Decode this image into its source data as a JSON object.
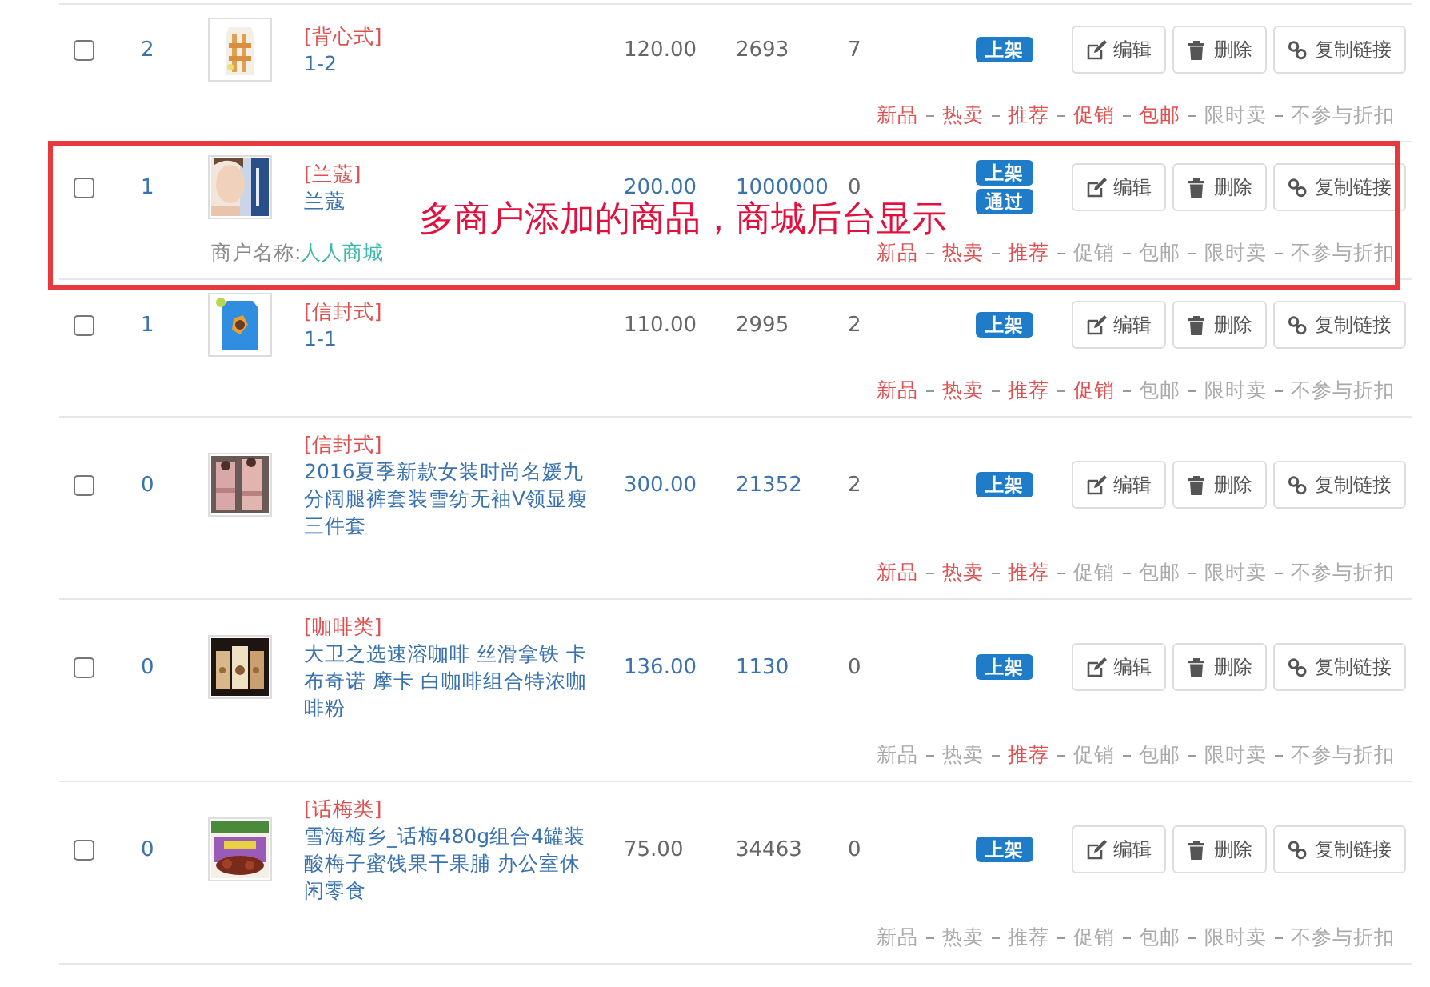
{
  "rows": [
    {
      "checked": false,
      "sort": "2",
      "image": {
        "kind": "picture"
      },
      "category": "[背心式]",
      "title": "1-2",
      "price": "120.00",
      "price_editable": false,
      "stock": "2693",
      "stock_editable": false,
      "sales": "7",
      "statuses": [
        "上架"
      ],
      "actions": [
        {
          "kind": "edit",
          "label": "编辑"
        },
        {
          "kind": "delete",
          "label": "删除"
        },
        {
          "kind": "link",
          "label": "复制链接"
        }
      ],
      "tags": [
        {
          "label": "新品",
          "on": true
        },
        {
          "label": "热卖",
          "on": true
        },
        {
          "label": "推荐",
          "on": true
        },
        {
          "label": "促销",
          "on": true
        },
        {
          "label": "包邮",
          "on": true
        },
        {
          "label": "限时卖",
          "on": false
        },
        {
          "label": "不参与折扣",
          "on": false
        }
      ]
    },
    {
      "checked": false,
      "sort": "1",
      "image": {
        "kind": "picture"
      },
      "category": "[兰蔻]",
      "title": "兰蔻",
      "price": "200.00",
      "price_editable": true,
      "stock": "1000000",
      "stock_editable": true,
      "sales": "0",
      "statuses": [
        "上架",
        "通过"
      ],
      "actions": [
        {
          "kind": "edit",
          "label": "编辑"
        },
        {
          "kind": "delete",
          "label": "删除"
        },
        {
          "kind": "link",
          "label": "复制链接"
        }
      ],
      "merchant": {
        "label": "商户名称:",
        "name": "人人商城"
      },
      "tags": [
        {
          "label": "新品",
          "on": true
        },
        {
          "label": "热卖",
          "on": true
        },
        {
          "label": "推荐",
          "on": true
        },
        {
          "label": "促销",
          "on": false
        },
        {
          "label": "包邮",
          "on": false
        },
        {
          "label": "限时卖",
          "on": false
        },
        {
          "label": "不参与折扣",
          "on": false
        }
      ],
      "annotation": {
        "text": "多商户添加的商品，商城后台显示"
      }
    },
    {
      "checked": false,
      "sort": "1",
      "image": {
        "kind": "picture"
      },
      "category": "[信封式]",
      "title": "1-1",
      "price": "110.00",
      "price_editable": false,
      "stock": "2995",
      "stock_editable": false,
      "sales": "2",
      "statuses": [
        "上架"
      ],
      "actions": [
        {
          "kind": "edit",
          "label": "编辑"
        },
        {
          "kind": "delete",
          "label": "删除"
        },
        {
          "kind": "link",
          "label": "复制链接"
        }
      ],
      "tags": [
        {
          "label": "新品",
          "on": true
        },
        {
          "label": "热卖",
          "on": true
        },
        {
          "label": "推荐",
          "on": true
        },
        {
          "label": "促销",
          "on": true
        },
        {
          "label": "包邮",
          "on": false
        },
        {
          "label": "限时卖",
          "on": false
        },
        {
          "label": "不参与折扣",
          "on": false
        }
      ]
    },
    {
      "checked": false,
      "sort": "0",
      "image": {
        "kind": "picture"
      },
      "category": "[信封式]",
      "title": "2016夏季新款女装时尚名媛九分阔腿裤套装雪纺无袖V领显瘦三件套",
      "price": "300.00",
      "price_editable": true,
      "stock": "21352",
      "stock_editable": true,
      "sales": "2",
      "statuses": [
        "上架"
      ],
      "actions": [
        {
          "kind": "edit",
          "label": "编辑"
        },
        {
          "kind": "delete",
          "label": "删除"
        },
        {
          "kind": "link",
          "label": "复制链接"
        }
      ],
      "tags": [
        {
          "label": "新品",
          "on": true
        },
        {
          "label": "热卖",
          "on": true
        },
        {
          "label": "推荐",
          "on": true
        },
        {
          "label": "促销",
          "on": false
        },
        {
          "label": "包邮",
          "on": false
        },
        {
          "label": "限时卖",
          "on": false
        },
        {
          "label": "不参与折扣",
          "on": false
        }
      ]
    },
    {
      "checked": false,
      "sort": "0",
      "image": {
        "kind": "picture"
      },
      "category": "[咖啡类]",
      "title": "大卫之选速溶咖啡 丝滑拿铁 卡布奇诺 摩卡 白咖啡组合特浓咖啡粉",
      "price": "136.00",
      "price_editable": true,
      "stock": "1130",
      "stock_editable": true,
      "sales": "0",
      "statuses": [
        "上架"
      ],
      "actions": [
        {
          "kind": "edit",
          "label": "编辑"
        },
        {
          "kind": "delete",
          "label": "删除"
        },
        {
          "kind": "link",
          "label": "复制链接"
        }
      ],
      "tags": [
        {
          "label": "新品",
          "on": false
        },
        {
          "label": "热卖",
          "on": false
        },
        {
          "label": "推荐",
          "on": true
        },
        {
          "label": "促销",
          "on": false
        },
        {
          "label": "包邮",
          "on": false
        },
        {
          "label": "限时卖",
          "on": false
        },
        {
          "label": "不参与折扣",
          "on": false
        }
      ]
    },
    {
      "checked": false,
      "sort": "0",
      "image": {
        "kind": "picture"
      },
      "category": "[话梅类]",
      "title": "雪海梅乡_话梅480g组合4罐装酸梅子蜜饯果干果脯 办公室休闲零食",
      "price": "75.00",
      "price_editable": false,
      "stock": "34463",
      "stock_editable": false,
      "sales": "0",
      "statuses": [
        "上架"
      ],
      "actions": [
        {
          "kind": "edit",
          "label": "编辑"
        },
        {
          "kind": "delete",
          "label": "删除"
        },
        {
          "kind": "link",
          "label": "复制链接"
        }
      ],
      "tags": [
        {
          "label": "新品",
          "on": false
        },
        {
          "label": "热卖",
          "on": false
        },
        {
          "label": "推荐",
          "on": false
        },
        {
          "label": "促销",
          "on": false
        },
        {
          "label": "包邮",
          "on": false
        },
        {
          "label": "限时卖",
          "on": false
        },
        {
          "label": "不参与折扣",
          "on": false
        }
      ]
    }
  ]
}
